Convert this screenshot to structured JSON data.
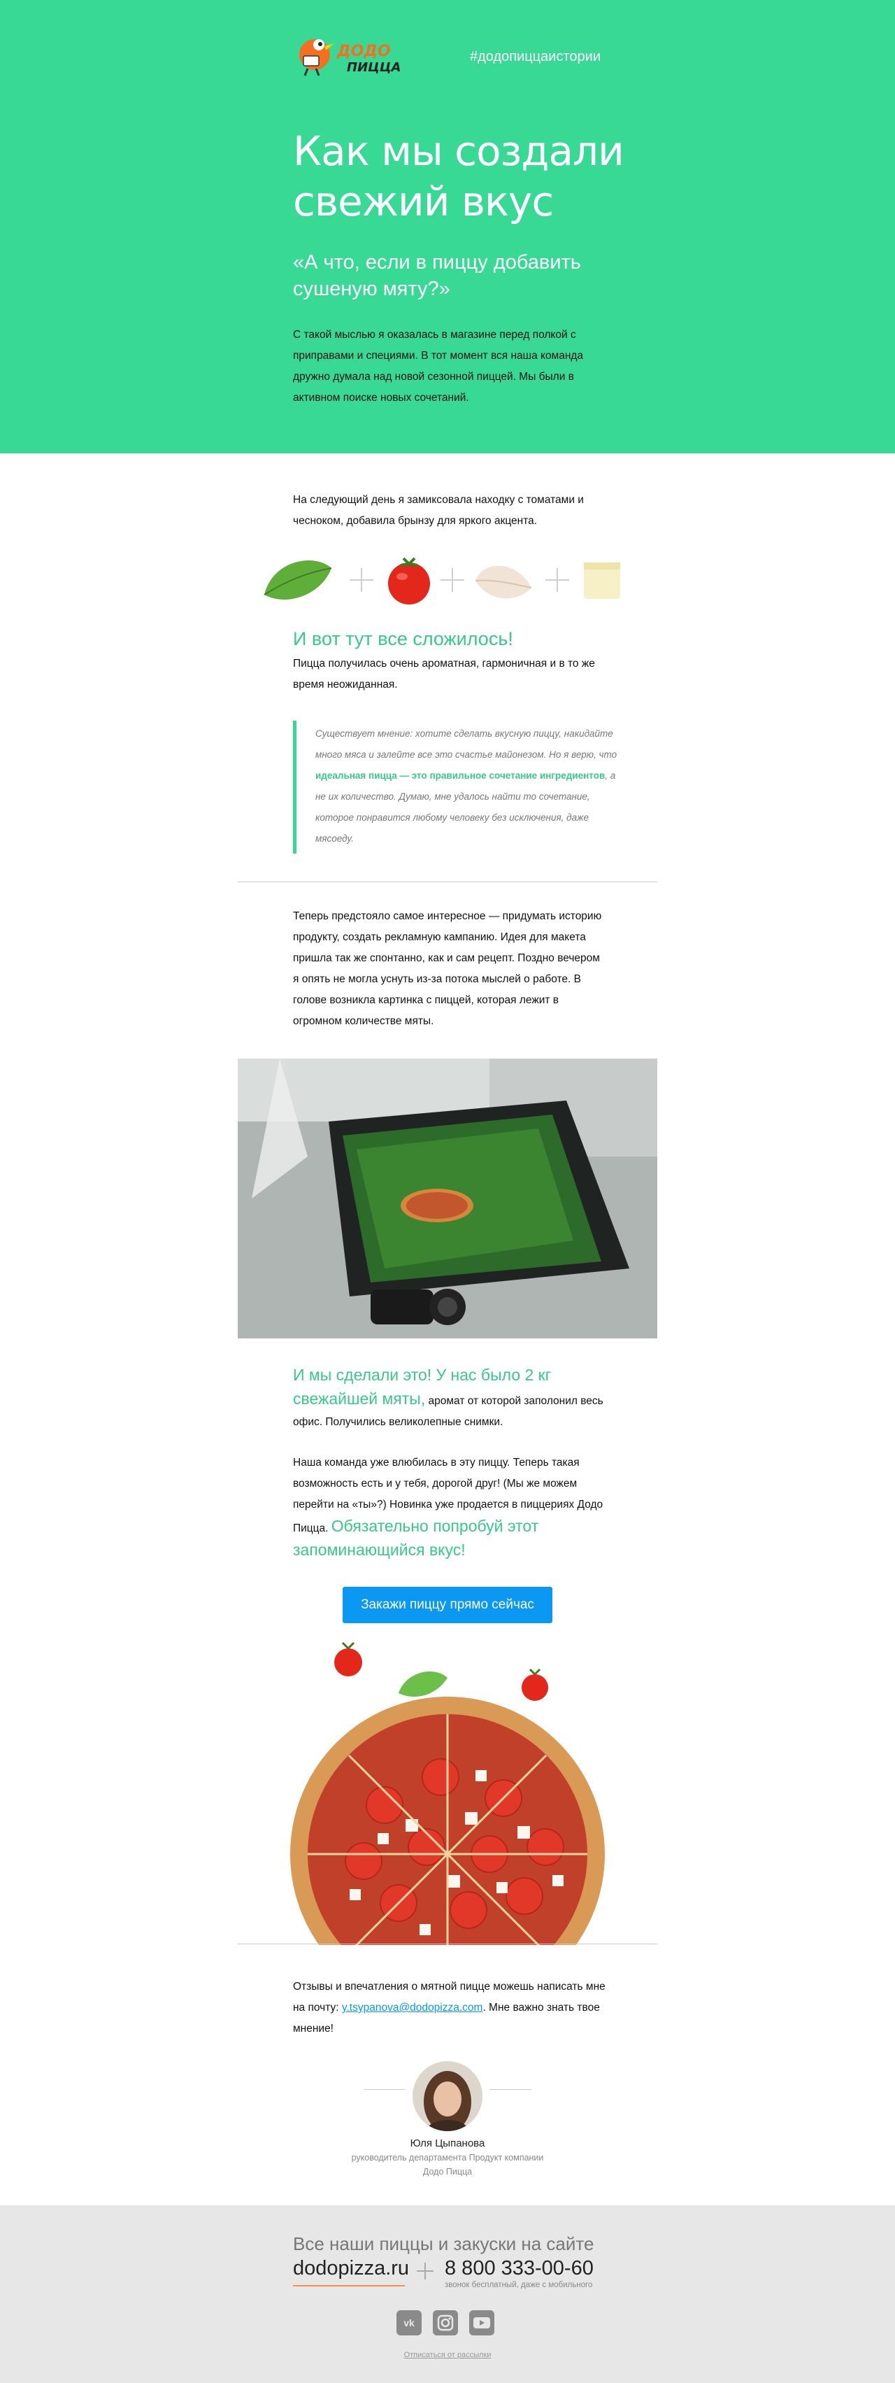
{
  "header": {
    "hashtag": "#додопиццаистории",
    "title": "Как мы создали свежий вкус",
    "quote": "«А что, если в пиццу добавить сушеную мяту?»",
    "intro": "С такой мыслью я оказалась в магазине перед полкой с приправами и специями. В тот момент вся наша команда дружно думала над новой сезонной пиццей. Мы были в активном поиске новых сочетаний."
  },
  "section1": {
    "paragraph": "На следующий день я замиксовала находку с томатами и чесноком, добавила брынзу для яркого акцента.",
    "ingredients": [
      "mint-leaf-icon",
      "tomato-icon",
      "garlic-icon",
      "cheese-icon"
    ],
    "subheading": "И вот тут все сложилось!",
    "paragraph2": "Пицца получилась очень ароматная, гармоничная и в то же время неожиданная."
  },
  "blockquote": {
    "part1": "Существует мнение: хотите сделать вкусную пиццу, накидайте много мяса и залейте все это счастье майонезом. Но я верю, что ",
    "highlight": "идеальная пицца — это правильное сочетание ингредиентов",
    "part2": ", а не их количество. Думаю, мне удалось найти то сочетание, которое понравится любому человеку без исключения, даже мясоеду."
  },
  "section2": {
    "paragraph": "Теперь предстояло самое интересное — придумать историю продукту, создать рекламную кампанию. Идея для макета пришла так же спонтанно, как и сам рецепт. Поздно вечером я опять не могла уснуть из-за потока мыслей о работе. В голове возникла картинка с пиццей, которая лежит в огромном количестве мяты.",
    "p4_big": "И мы сделали это! У нас было 2 кг свежайшей мяты,",
    "p4_rest": " аромат от которой заполонил весь офис. Получились великолепные снимки.",
    "p5_text": "Наша команда уже влюбилась в эту пиццу. Теперь такая возможность есть и у тебя, дорогой друг! (Мы же можем перейти на «ты»?) Новинка уже продается в пиццериях Додо Пицца. ",
    "p5_big": "Обязательно попробуй этот запоминающийся вкус!",
    "cta": "Закажи пиццу прямо сейчас"
  },
  "feedback": {
    "text1": "Отзывы и впечатления о мятной пицце можешь написать мне на почту: ",
    "email": "y.tsypanova@dodopizza.com",
    "text2": ". Мне важно знать твое мнение!"
  },
  "signature": {
    "name": "Юля Цыпанова",
    "role": "руководитель департамента Продукт компании Додо Пицца"
  },
  "footer": {
    "title": "Все наши пиццы и закуски на сайте",
    "site": "dodopizza.ru",
    "phone": "8 800 333-00-60",
    "phone_note": "звонок бесплатный, даже с мобильного",
    "socials": [
      "vk-icon",
      "instagram-icon",
      "youtube-icon"
    ],
    "unsubscribe": "Отписаться от рассылки"
  },
  "colors": {
    "brand_green": "#38d995",
    "accent_blue": "#0a98f3",
    "accent_orange": "#f3934b"
  }
}
